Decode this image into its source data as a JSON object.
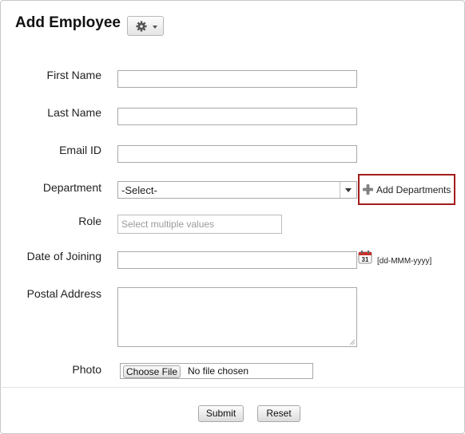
{
  "header": {
    "title": "Add Employee",
    "settings_icon": "gear-icon",
    "settings_dropdown_icon": "chevron-down-icon"
  },
  "form": {
    "first_name": {
      "label": "First Name",
      "value": ""
    },
    "last_name": {
      "label": "Last Name",
      "value": ""
    },
    "email": {
      "label": "Email ID",
      "value": ""
    },
    "department": {
      "label": "Department",
      "selected": "-Select-",
      "add_link": "Add Departments",
      "add_icon": "plus-icon"
    },
    "role": {
      "label": "Role",
      "placeholder": "Select multiple values",
      "value": ""
    },
    "date_of_joining": {
      "label": "Date of Joining",
      "value": "",
      "format_hint": "[dd-MMM-yyyy]",
      "calendar_icon": "calendar-icon",
      "calendar_day": "31"
    },
    "postal_address": {
      "label": "Postal Address",
      "value": ""
    },
    "photo": {
      "label": "Photo",
      "button": "Choose File",
      "status": "No file chosen"
    }
  },
  "actions": {
    "submit": "Submit",
    "reset": "Reset"
  },
  "colors": {
    "highlight_border": "#a21c1c",
    "calendar_red": "#c9302c"
  }
}
